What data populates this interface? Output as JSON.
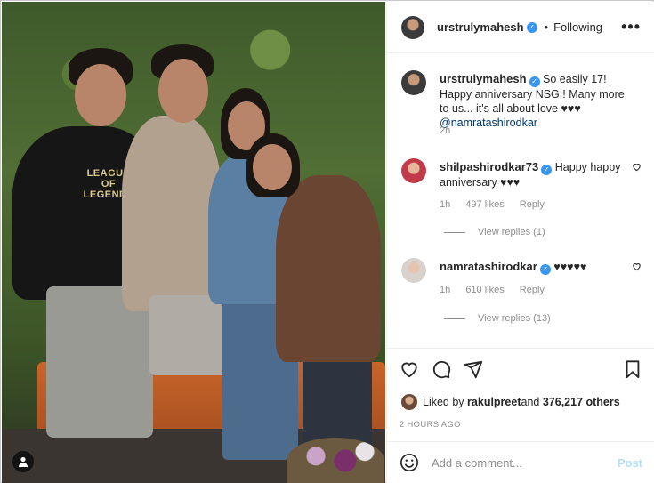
{
  "post": {
    "author": "urstrulymahesh",
    "separator": "•",
    "follow_status": "Following",
    "more": "•••",
    "photo_shirt_text": "LEAGUE OF LEGENDS",
    "caption": {
      "username": "urstrulymahesh",
      "text": "So easily 17! Happy anniversary NSG!! Many more to us... it's all about love ♥♥♥",
      "mention": "@namratashirodkar",
      "time": "2h"
    }
  },
  "comments": [
    {
      "username": "shilpashirodkar73",
      "text": "Happy happy anniversary ♥♥♥",
      "time": "1h",
      "likes": "497 likes",
      "reply": "Reply",
      "view_replies": "View replies (1)"
    },
    {
      "username": "namratashirodkar",
      "text": "♥♥♥♥♥",
      "time": "1h",
      "likes": "610 likes",
      "reply": "Reply",
      "view_replies": "View replies (13)"
    }
  ],
  "engagement": {
    "liked_prefix": "Liked by ",
    "liked_user": "rakulpreet",
    "liked_suffix": " and ",
    "others": "376,217 others",
    "timestamp": "2 HOURS AGO"
  },
  "composer": {
    "placeholder": "Add a comment...",
    "post_label": "Post"
  },
  "icons": {
    "like": "heart-icon",
    "comment": "comment-icon",
    "share": "paper-plane-icon",
    "save": "bookmark-icon",
    "emoji": "emoji-icon",
    "user_tag": "person-icon"
  }
}
